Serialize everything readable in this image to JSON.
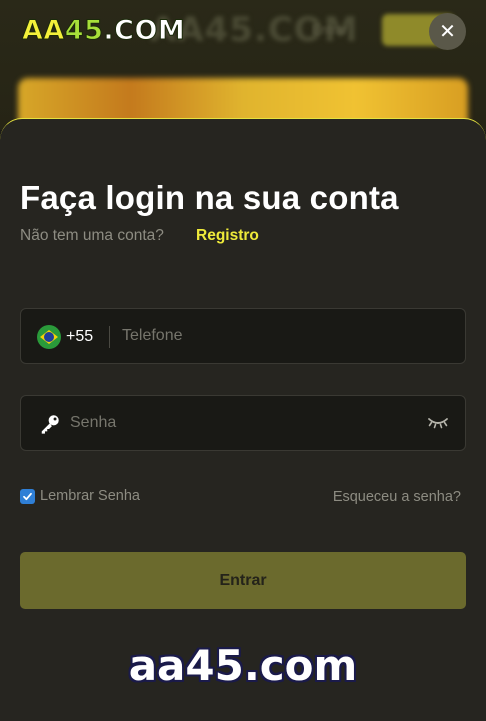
{
  "header": {
    "logo": {
      "aa": "AA",
      "num": "45",
      "com": ".COM"
    },
    "close_label": "✕"
  },
  "login": {
    "title": "Faça login na sua conta",
    "no_account": "Não tem uma conta?",
    "register": "Registro",
    "phone": {
      "country_code": "+55",
      "placeholder": "Telefone",
      "flag": "brazil-flag"
    },
    "password": {
      "placeholder": "Senha",
      "icon": "key-icon",
      "toggle_icon": "eye-closed-icon"
    },
    "remember": {
      "label": "Lembrar Senha",
      "checked": true
    },
    "forgot": "Esqueceu a senha?",
    "submit": "Entrar"
  },
  "watermark": "aa45.com",
  "colors": {
    "accent": "#eeea3a",
    "sheet": "#262520",
    "field": "#191915",
    "button": "#6b6a2d",
    "checkbox": "#2f7fd6"
  }
}
